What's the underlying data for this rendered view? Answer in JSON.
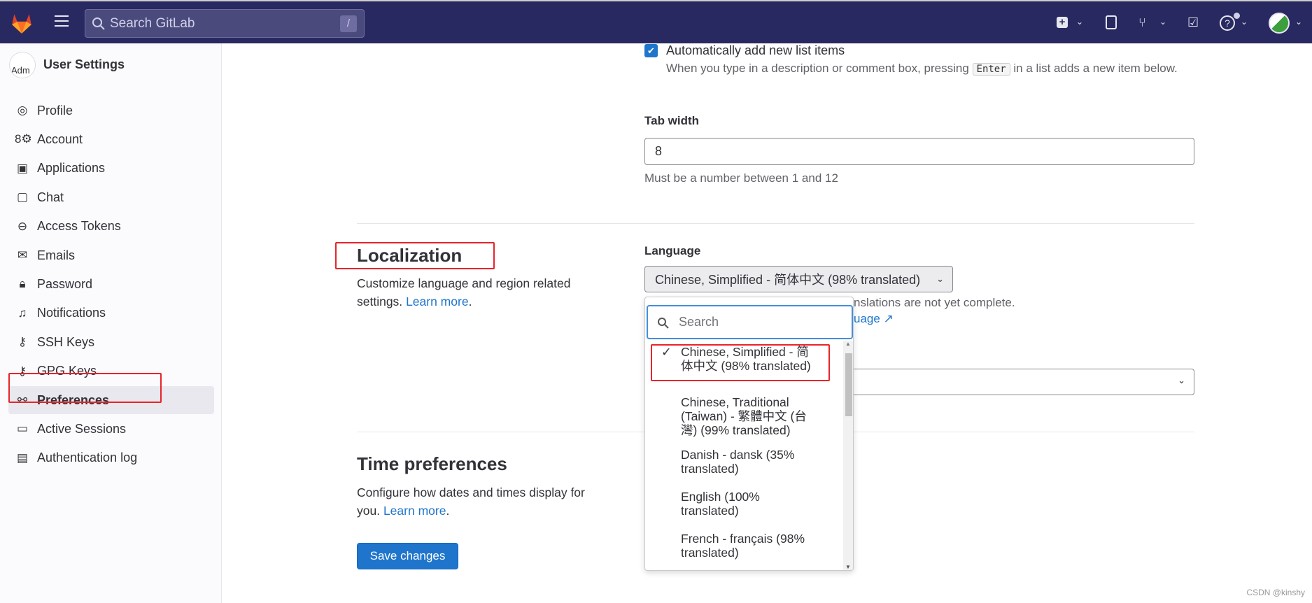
{
  "header": {
    "search_placeholder": "Search GitLab",
    "search_shortcut": "/",
    "icons": [
      "gitlab-logo",
      "hamburger-icon",
      "plus-square-icon",
      "issues-icon",
      "merge-request-icon",
      "todo-icon",
      "help-icon",
      "avatar"
    ]
  },
  "sidebar": {
    "title": "User Settings",
    "avatar_alt": "Adm",
    "items": [
      {
        "label": "Profile",
        "icon": "profile-icon"
      },
      {
        "label": "Account",
        "icon": "account-icon"
      },
      {
        "label": "Applications",
        "icon": "applications-icon"
      },
      {
        "label": "Chat",
        "icon": "chat-icon"
      },
      {
        "label": "Access Tokens",
        "icon": "token-icon"
      },
      {
        "label": "Emails",
        "icon": "mail-icon"
      },
      {
        "label": "Password",
        "icon": "lock-icon"
      },
      {
        "label": "Notifications",
        "icon": "bell-icon"
      },
      {
        "label": "SSH Keys",
        "icon": "key-icon"
      },
      {
        "label": "GPG Keys",
        "icon": "key-icon"
      },
      {
        "label": "Preferences",
        "icon": "preferences-icon",
        "active": true
      },
      {
        "label": "Active Sessions",
        "icon": "monitor-icon"
      },
      {
        "label": "Authentication log",
        "icon": "log-icon"
      }
    ]
  },
  "behavior": {
    "auto_list_label": "Automatically add new list items",
    "auto_list_checked": true,
    "auto_list_help_before": "When you type in a description or comment box, pressing",
    "auto_list_help_key": "Enter",
    "auto_list_help_after": "in a list adds a new item below.",
    "tab_width_label": "Tab width",
    "tab_width_value": "8",
    "tab_width_help": "Must be a number between 1 and 12"
  },
  "localization": {
    "title": "Localization",
    "desc": "Customize language and region related settings.",
    "learn_more": "Learn more",
    "language_label": "Language",
    "language_value": "Chinese, Simplified - 简体中文 (98% translated)",
    "partial_help": "nslations are not yet complete.",
    "partial_link": "uage",
    "dropdown": {
      "search_placeholder": "Search",
      "options": [
        {
          "label": "Chinese, Simplified - 简体中文 (98% translated)",
          "selected": true
        },
        {
          "label": "Chinese, Traditional (Taiwan) - 繁體中文 (台灣) (99% translated)"
        },
        {
          "label": "Danish - dansk (35% translated)"
        },
        {
          "label": "English (100% translated)"
        },
        {
          "label": "French - français (98% translated)"
        }
      ]
    }
  },
  "time": {
    "title": "Time preferences",
    "desc": "Configure how dates and times display for you.",
    "learn_more": "Learn more"
  },
  "save_label": "Save changes",
  "watermark": "CSDN @kinshy",
  "colors": {
    "header": "#292961",
    "accent": "#1f75cb",
    "highlight": "#e8242a"
  }
}
